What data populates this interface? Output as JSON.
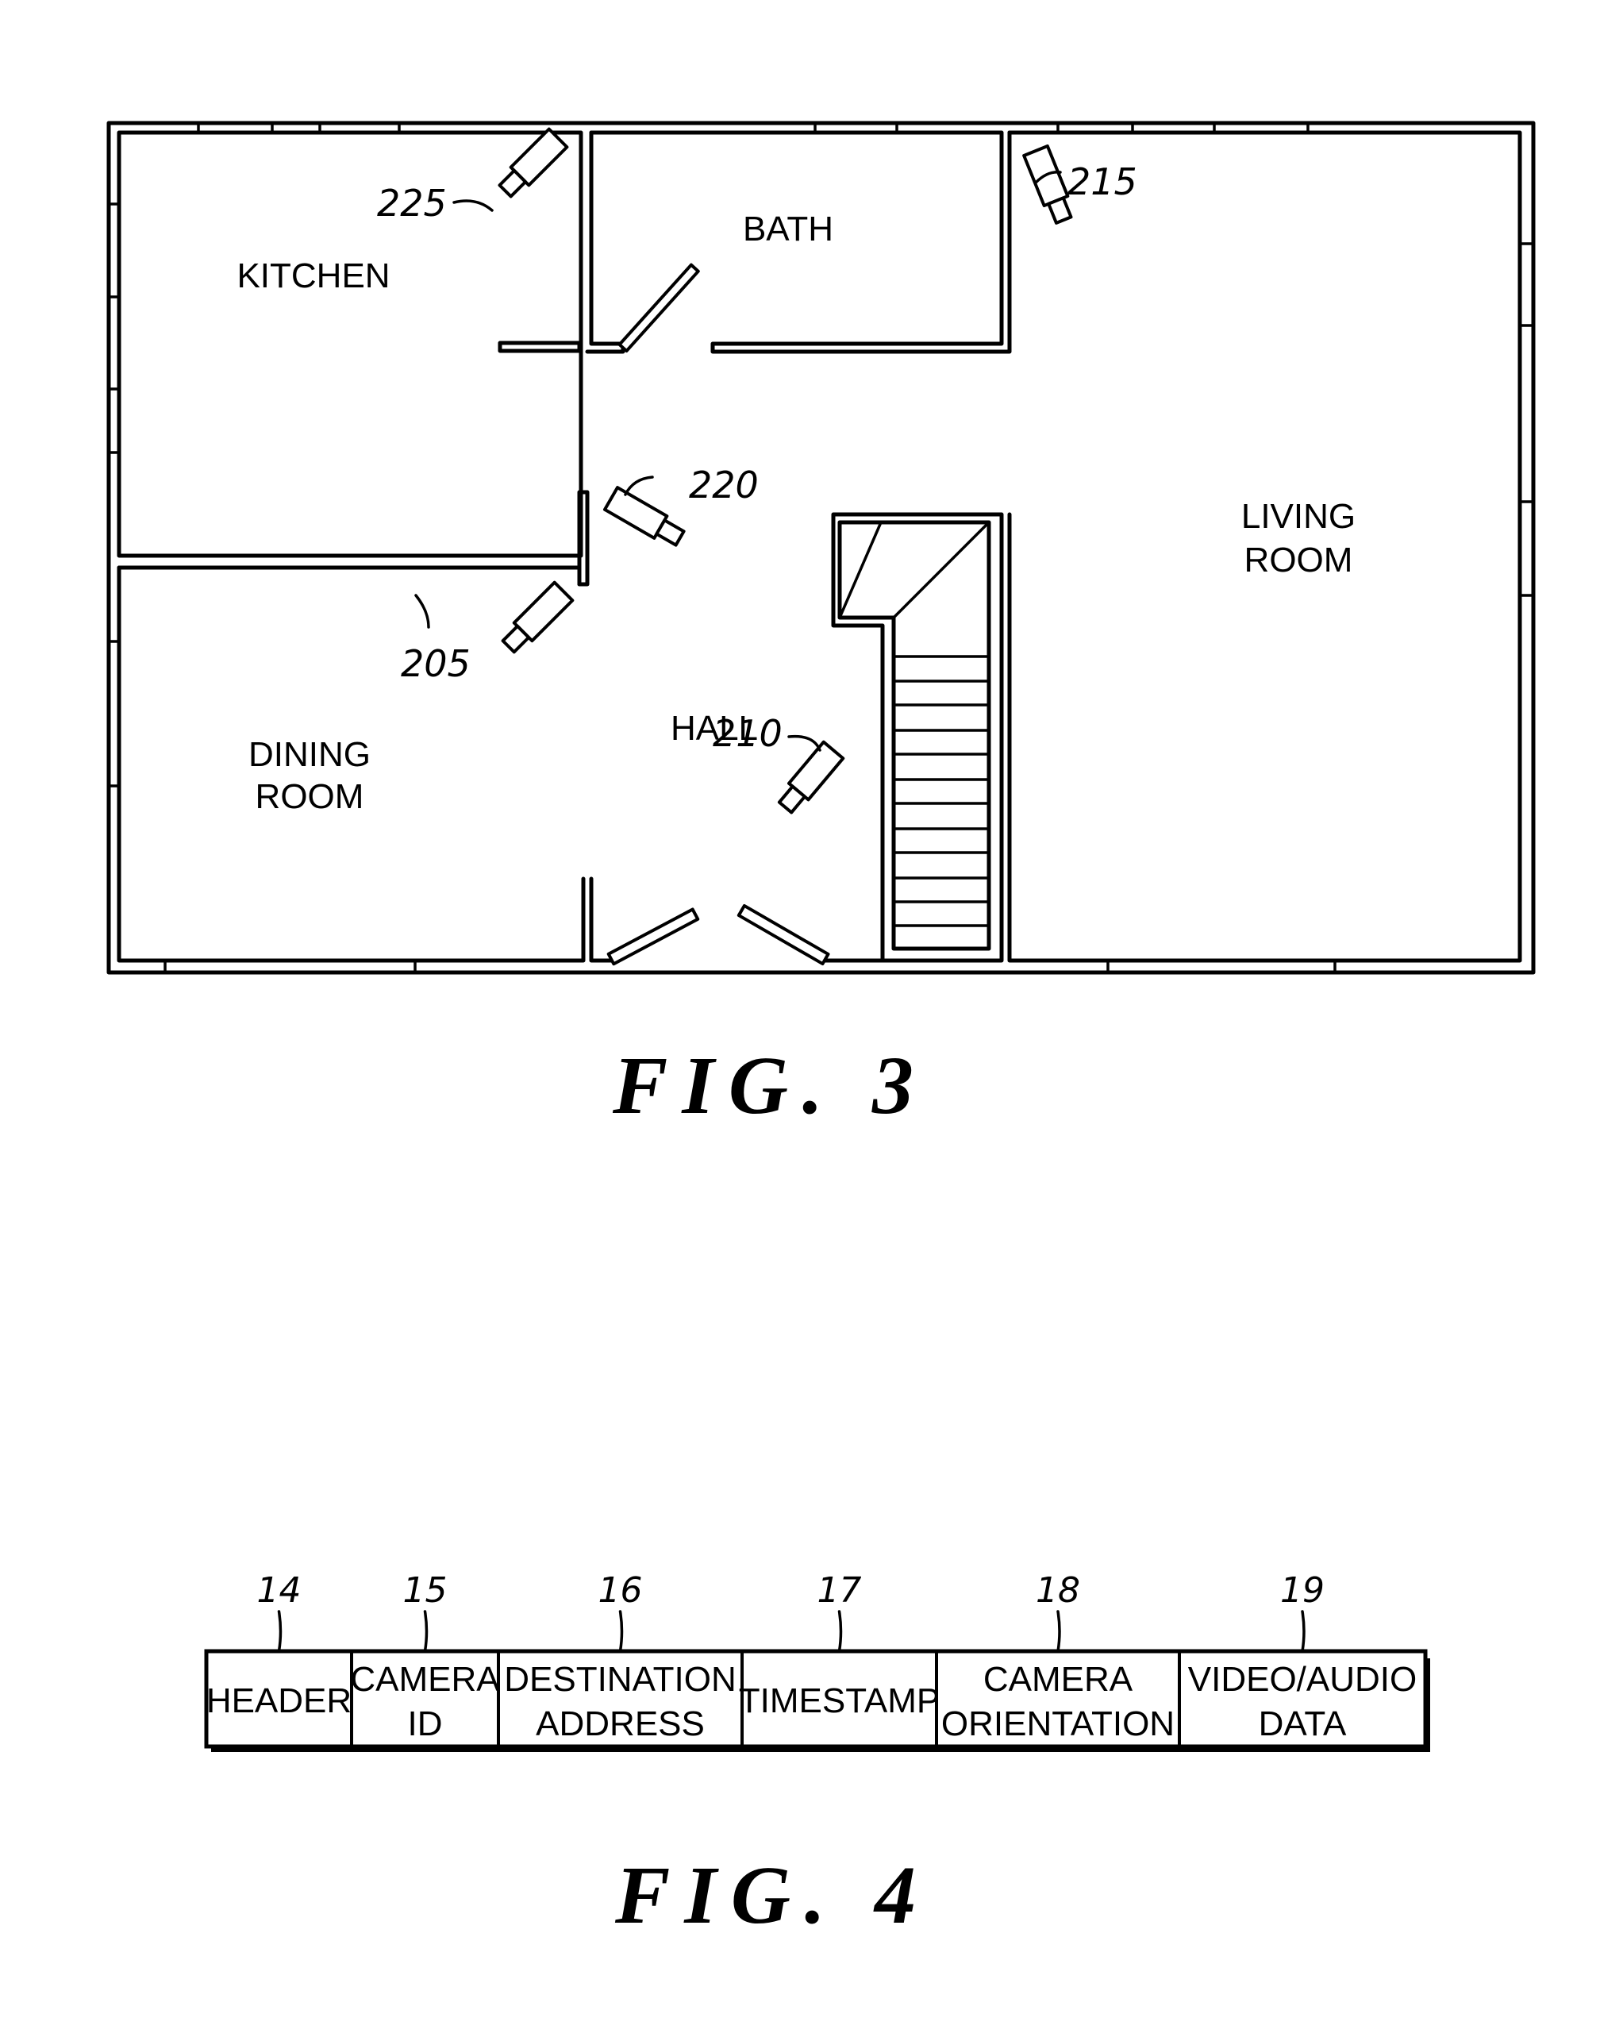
{
  "figure3": {
    "caption": "FIG. 3",
    "rooms": {
      "kitchen": [
        "KITCHEN"
      ],
      "bath": [
        "BATH"
      ],
      "living_room": [
        "LIVING",
        "ROOM"
      ],
      "dining_room": [
        "DINING",
        "ROOM"
      ],
      "hall": [
        "HALL"
      ]
    },
    "cameras": [
      {
        "id": "225",
        "room": "KITCHEN"
      },
      {
        "id": "215",
        "room": "LIVING ROOM"
      },
      {
        "id": "220",
        "room": "HALL"
      },
      {
        "id": "205",
        "room": "HALL"
      },
      {
        "id": "210",
        "room": "HALL"
      }
    ]
  },
  "figure4": {
    "caption": "FIG. 4",
    "fields": [
      {
        "ref": "14",
        "lines": [
          "HEADER"
        ]
      },
      {
        "ref": "15",
        "lines": [
          "CAMERA",
          "ID"
        ]
      },
      {
        "ref": "16",
        "lines": [
          "DESTINATION",
          "ADDRESS"
        ]
      },
      {
        "ref": "17",
        "lines": [
          "TIMESTAMP"
        ]
      },
      {
        "ref": "18",
        "lines": [
          "CAMERA",
          "ORIENTATION"
        ]
      },
      {
        "ref": "19",
        "lines": [
          "VIDEO/AUDIO",
          "DATA"
        ]
      }
    ]
  }
}
